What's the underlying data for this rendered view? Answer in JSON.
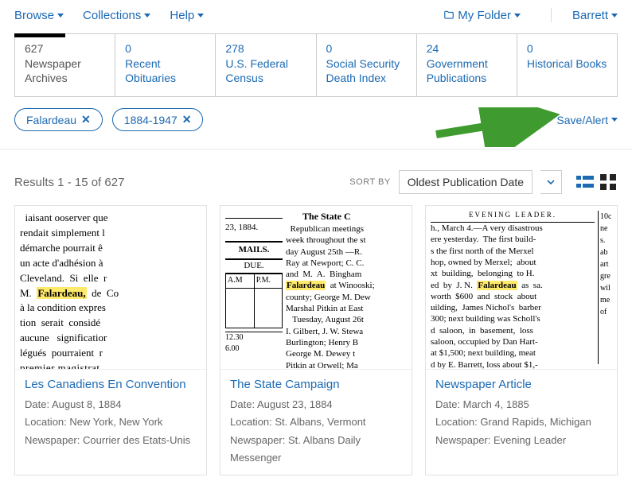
{
  "nav": {
    "browse": "Browse",
    "collections": "Collections",
    "help": "Help",
    "my_folder": "My Folder",
    "account": "Barrett"
  },
  "tabs": [
    {
      "count": "627",
      "label": "Newspaper Archives"
    },
    {
      "count": "0",
      "label": "Recent Obituaries"
    },
    {
      "count": "278",
      "label": "U.S. Federal Census"
    },
    {
      "count": "0",
      "label": "Social Security Death Index"
    },
    {
      "count": "24",
      "label": "Government Publications"
    },
    {
      "count": "0",
      "label": "Historical Books"
    }
  ],
  "chips": {
    "term": "Falardeau",
    "range": "1884-1947"
  },
  "save_alert": "Save/Alert",
  "results_count": "Results 1 - 15 of 627",
  "sort_label": "SORT BY",
  "sort_value": "Oldest Publication Date",
  "cards": [
    {
      "title": "Les Canadiens En Convention",
      "date": "Date: August 8, 1884",
      "location": "Location: New York, New York",
      "newspaper": "Newspaper: Courrier des Etats-Unis"
    },
    {
      "title": "The State Campaign",
      "date": "Date: August 23, 1884",
      "location": "Location: St. Albans, Vermont",
      "newspaper": "Newspaper: St. Albans Daily Messenger"
    },
    {
      "title": "Newspaper Article",
      "date": "Date: March 4, 1885",
      "location": "Location: Grand Rapids, Michigan",
      "newspaper": "Newspaper: Evening Leader"
    }
  ]
}
